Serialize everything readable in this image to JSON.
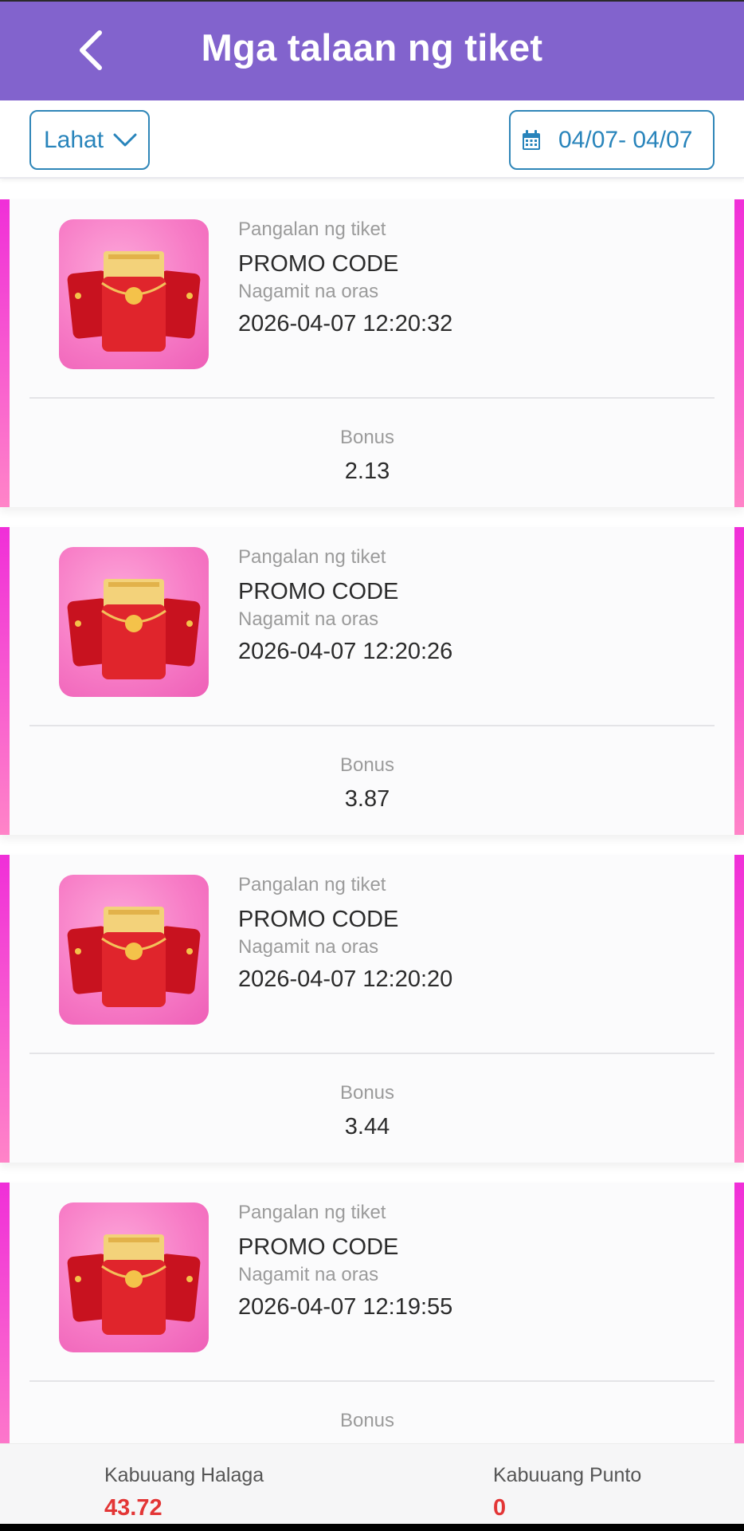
{
  "header": {
    "title": "Mga talaan ng tiket",
    "back_icon": "chevron-left-icon"
  },
  "filter": {
    "type_label": "Lahat",
    "date_range": "04/07- 04/07"
  },
  "labels": {
    "ticket_name": "Pangalan ng tiket",
    "used_time": "Nagamit na oras",
    "bonus": "Bonus"
  },
  "tickets": [
    {
      "name": "PROMO CODE",
      "time": "2026-04-07 12:20:32",
      "bonus": "2.13"
    },
    {
      "name": "PROMO CODE",
      "time": "2026-04-07 12:20:26",
      "bonus": "3.87"
    },
    {
      "name": "PROMO CODE",
      "time": "2026-04-07 12:20:20",
      "bonus": "3.44"
    },
    {
      "name": "PROMO CODE",
      "time": "2026-04-07 12:19:55",
      "bonus": ""
    }
  ],
  "footer": {
    "total_amount_label": "Kabuuang Halaga",
    "total_amount": "43.72",
    "total_points_label": "Kabuuang Punto",
    "total_points": "0"
  },
  "colors": {
    "header": "#8263cd",
    "accent": "#2884bb",
    "total": "#e33636",
    "side_bar": "#f02fd8"
  }
}
